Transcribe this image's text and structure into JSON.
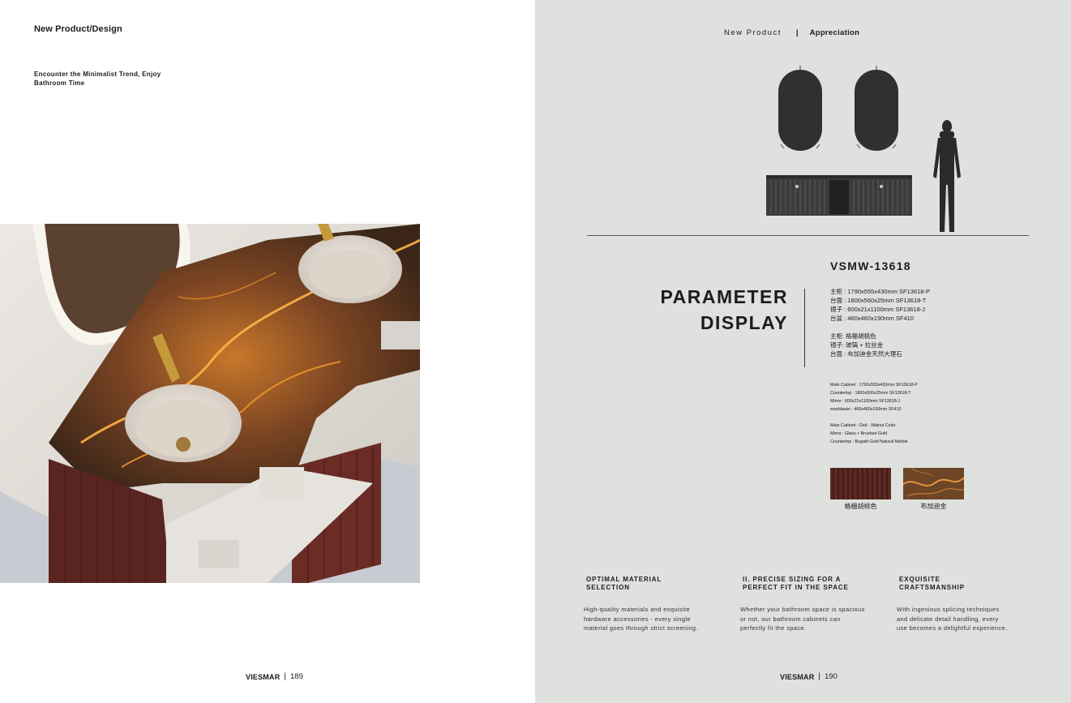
{
  "left_page": {
    "section": "New Product/Design",
    "intro_line1": "Encounter the Minimalist Trend, Enjoy",
    "intro_line2": "Bathroom Time",
    "folio": {
      "brand": "VIESMAR",
      "sep": "|",
      "page": "189"
    }
  },
  "right_page": {
    "nav": {
      "item1": "New Product",
      "sep": "|",
      "item2": "Appreciation"
    },
    "model": "VSMW-13618",
    "title_line1": "PARAMETER",
    "title_line2": "DISPLAY",
    "spec_cn": [
      "主柜 : 1790x555x430mm SF13618-P",
      "台面 : 1800x560x25mm SF13618-T",
      "镜子 : 600x21x1100mm SF13618-J",
      "台盆 : 460x460x190mm SF410"
    ],
    "spec_cn_materials": [
      "主柜:  格栅胡桃色",
      "镜子:  玻璃 + 拉丝金",
      "台面 : 布加迪金天然大理石"
    ],
    "spec_en": [
      "Main Cabinet : 1790x555x430mm SF13618-P",
      "Countertop : 1800x560x25mm SF13618-T",
      "Mirror : 600x21x1100mm SF13618-J",
      "washbasin : 460x460x190mm SF410"
    ],
    "spec_en_materials": [
      "Main Cabinet : Grid - Walnut Color",
      "Mirror : Glass + Brushed Gold",
      "Countertop : Bugatti Gold Natural Marble"
    ],
    "swatches": [
      {
        "label": "格栅胡桃色",
        "color": "#5a2a22"
      },
      {
        "label": "布加迪金",
        "color": "#7a4a2a"
      }
    ],
    "features": [
      {
        "title_line1": "OPTIMAL MATERIAL",
        "title_line2": "SELECTION",
        "body": [
          "High-quality materials and exquisite",
          "hardware accessories - every single",
          "material goes through strict screening."
        ]
      },
      {
        "title_line1": "II. PRECISE SIZING FOR A",
        "title_line2": "PERFECT FIT IN THE SPACE",
        "body": [
          "Whether your bathroom space is spacious",
          "or not, our bathroom cabinets can",
          "perfectly fit the space."
        ]
      },
      {
        "title_line1": "EXQUISITE",
        "title_line2": "CRAFTSMANSHIP",
        "body": [
          "With ingenious splicing techniques",
          "and delicate detail handling, every",
          "use becomes a delightful experience."
        ]
      }
    ],
    "folio": {
      "brand": "VIESMAR",
      "sep": "|",
      "page": "190"
    }
  },
  "colors": {
    "right_bg": "#dfe1de",
    "mirror": "#2f3130",
    "cabinet": "#3a3b3a",
    "ink": "#1c1c1c"
  }
}
